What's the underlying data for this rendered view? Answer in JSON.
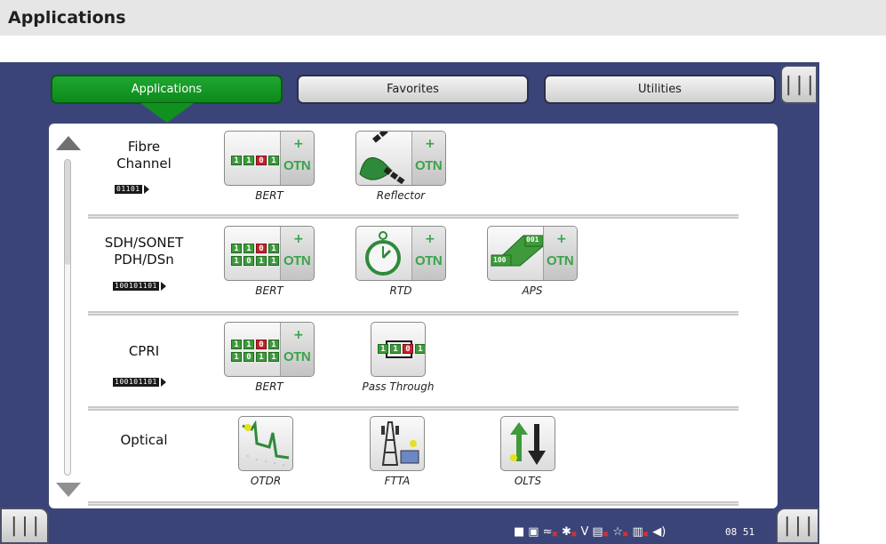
{
  "page": {
    "title": "Applications"
  },
  "tabs": [
    {
      "label": "Applications",
      "active": true
    },
    {
      "label": "Favorites",
      "active": false
    },
    {
      "label": "Utilities",
      "active": false
    }
  ],
  "side_buttons": {
    "menu_glyph": "|||"
  },
  "categories": [
    {
      "label_line1": "Fibre",
      "label_line2": "Channel",
      "bitstream": "01101",
      "apps": [
        {
          "label": "BERT",
          "icon": "bert-otn-icon"
        },
        {
          "label": "Reflector",
          "icon": "reflector-otn-icon"
        }
      ]
    },
    {
      "label_line1": "SDH/SONET",
      "label_line2": "PDH/DSn",
      "bitstream": "100101101",
      "apps": [
        {
          "label": "BERT",
          "icon": "bert-otn-icon"
        },
        {
          "label": "RTD",
          "icon": "stopwatch-otn-icon"
        },
        {
          "label": "APS",
          "icon": "aps-otn-icon"
        }
      ]
    },
    {
      "label_line1": "CPRI",
      "bitstream": "100101101",
      "apps": [
        {
          "label": "BERT",
          "icon": "bert-otn-icon"
        },
        {
          "label": "Pass Through",
          "icon": "pass-through-icon"
        }
      ]
    },
    {
      "label_line1": "Optical",
      "apps": [
        {
          "label": "OTDR",
          "icon": "otdr-icon"
        },
        {
          "label": "FTTA",
          "icon": "ftta-tower-icon"
        },
        {
          "label": "OLTS",
          "icon": "olts-arrows-icon"
        }
      ]
    }
  ],
  "icon_text": {
    "otn": "OTN",
    "plus": "+",
    "bert_row1": [
      "1",
      "1",
      "0",
      "1"
    ],
    "bert_row2": [
      "1",
      "0",
      "1",
      "1"
    ],
    "aps_bits_a": "001",
    "aps_bits_b": "100",
    "pass_bits": [
      "1",
      "1",
      "0",
      "1"
    ]
  },
  "status_bar": {
    "clock": "08 51",
    "icons": [
      "plug-icon",
      "storage-icon",
      "wifi-icon",
      "bluetooth-icon",
      "v-icon",
      "terminal-icon",
      "satellite-icon",
      "network-icon",
      "speaker-icon"
    ]
  },
  "colors": {
    "accent": "#0c8a1c",
    "device_bg": "#3a4478",
    "header_bg": "#e6e6e6",
    "otn_green": "#3aa34a"
  }
}
